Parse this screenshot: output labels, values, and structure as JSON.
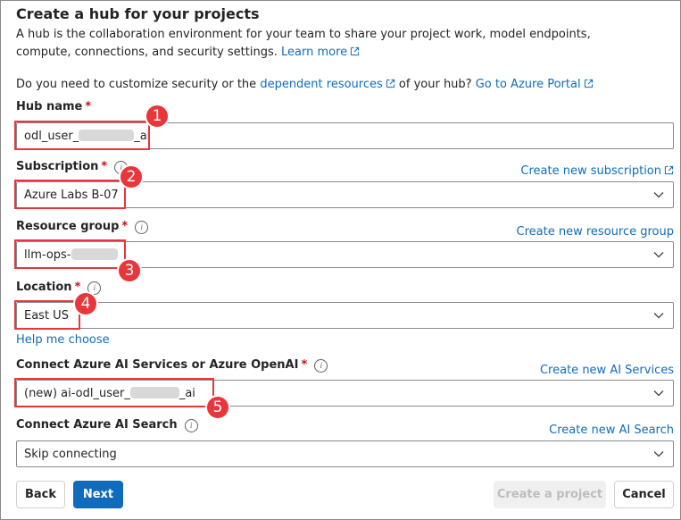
{
  "header": {
    "title": "Create a hub for your projects",
    "description": "A hub is the collaboration environment for your team to share your project work, model endpoints, compute, connections, and security settings.",
    "learn_more": "Learn more"
  },
  "customize": {
    "prefix": "Do you need to customize security or the",
    "dependent_link": "dependent resources",
    "middle": "of your hub?",
    "portal_link": "Go to Azure Portal"
  },
  "form": {
    "hub_name": {
      "label": "Hub name",
      "required": "*",
      "value_prefix": "odl_user_",
      "value_suffix": "_ai",
      "callout": "1"
    },
    "subscription": {
      "label": "Subscription",
      "required": "*",
      "create_link": "Create new subscription",
      "value": "Azure Labs B-07",
      "callout": "2"
    },
    "resource_group": {
      "label": "Resource group",
      "required": "*",
      "create_link": "Create new resource group",
      "value_prefix": "llm-ops-",
      "callout": "3"
    },
    "location": {
      "label": "Location",
      "required": "*",
      "value": "East US",
      "help_link": "Help me choose",
      "callout": "4"
    },
    "ai_services": {
      "label": "Connect Azure AI Services or Azure OpenAI",
      "required": "*",
      "create_link": "Create new AI Services",
      "value_prefix": "(new) ai-odl_user_",
      "value_suffix": "_ai",
      "callout": "5"
    },
    "ai_search": {
      "label": "Connect Azure AI Search",
      "create_link": "Create new AI Search",
      "value": "Skip connecting"
    }
  },
  "footer": {
    "back": "Back",
    "next": "Next",
    "create": "Create a project",
    "cancel": "Cancel"
  },
  "colors": {
    "link": "#0f6cbd",
    "primary_button": "#0f6cbd",
    "callout_red": "#e8363b",
    "required_star": "#c50f1f"
  }
}
